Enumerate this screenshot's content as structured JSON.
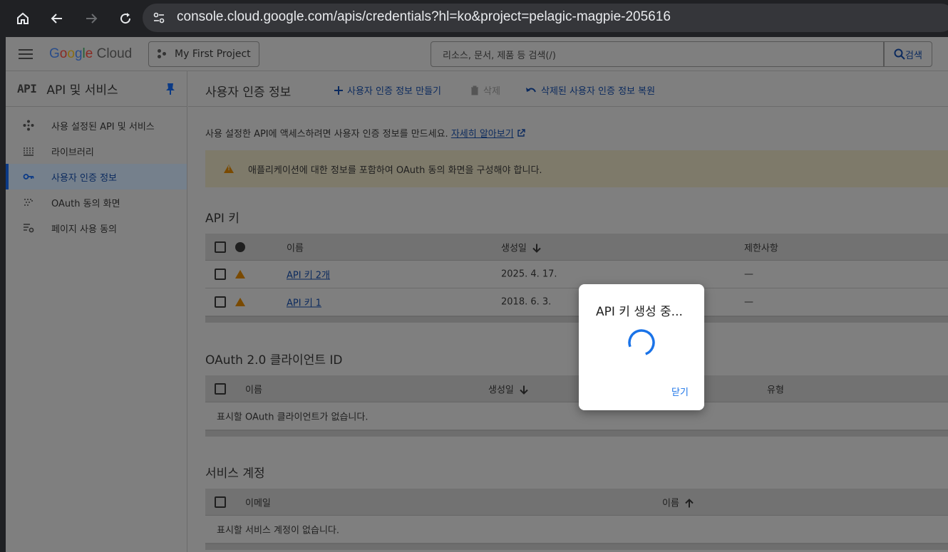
{
  "browser": {
    "url": "console.cloud.google.com/apis/credentials?hl=ko&project=pelagic-magpie-205616"
  },
  "header": {
    "logo_letters": [
      "G",
      "o",
      "o",
      "g",
      "l",
      "e"
    ],
    "logo_cloud": "Cloud",
    "project": "My First Project",
    "search_placeholder": "리소스, 문서, 제품 등 검색(/)",
    "search_button": "검색"
  },
  "sidebar": {
    "badge": "API",
    "title": "API 및 서비스",
    "items": [
      {
        "label": "사용 설정된 API 및 서비스",
        "icon": "diamond-dots-icon"
      },
      {
        "label": "라이브러리",
        "icon": "library-icon"
      },
      {
        "label": "사용자 인증 정보",
        "icon": "key-icon",
        "active": true
      },
      {
        "label": "OAuth 동의 화면",
        "icon": "dots-grid-icon"
      },
      {
        "label": "페이지 사용 동의",
        "icon": "settings-list-icon"
      }
    ]
  },
  "toolbar": {
    "title": "사용자 인증 정보",
    "create": "사용자 인증 정보 만들기",
    "delete": "삭제",
    "restore": "삭제된 사용자 인증 정보 복원"
  },
  "intro": {
    "text": "사용 설정한 API에 액세스하려면 사용자 인증 정보를 만드세요.",
    "link": "자세히 알아보기"
  },
  "banner": {
    "text": "애플리케이션에 대한 정보를 포함하여 OAuth 동의 화면을 구성해야 합니다."
  },
  "api_keys": {
    "title": "API 키",
    "headers": {
      "name": "이름",
      "created": "생성일",
      "restrictions": "제한사항"
    },
    "rows": [
      {
        "name": "API 키 2개",
        "created": "2025. 4. 17.",
        "restrictions": "—"
      },
      {
        "name": "API 키 1",
        "created": "2018. 6. 3.",
        "restrictions": "—"
      }
    ]
  },
  "oauth": {
    "title": "OAuth 2.0 클라이언트 ID",
    "headers": {
      "name": "이름",
      "created": "생성일",
      "type": "유형"
    },
    "empty": "표시할 OAuth 클라이언트가 없습니다."
  },
  "service_accounts": {
    "title": "서비스 계정",
    "headers": {
      "email": "이메일",
      "name": "이름"
    },
    "empty": "표시할 서비스 계정이 없습니다."
  },
  "dialog": {
    "title": "API 키 생성 중...",
    "close": "닫기"
  },
  "colors": {
    "accent": "#1a73e8",
    "warning": "#e37400"
  }
}
